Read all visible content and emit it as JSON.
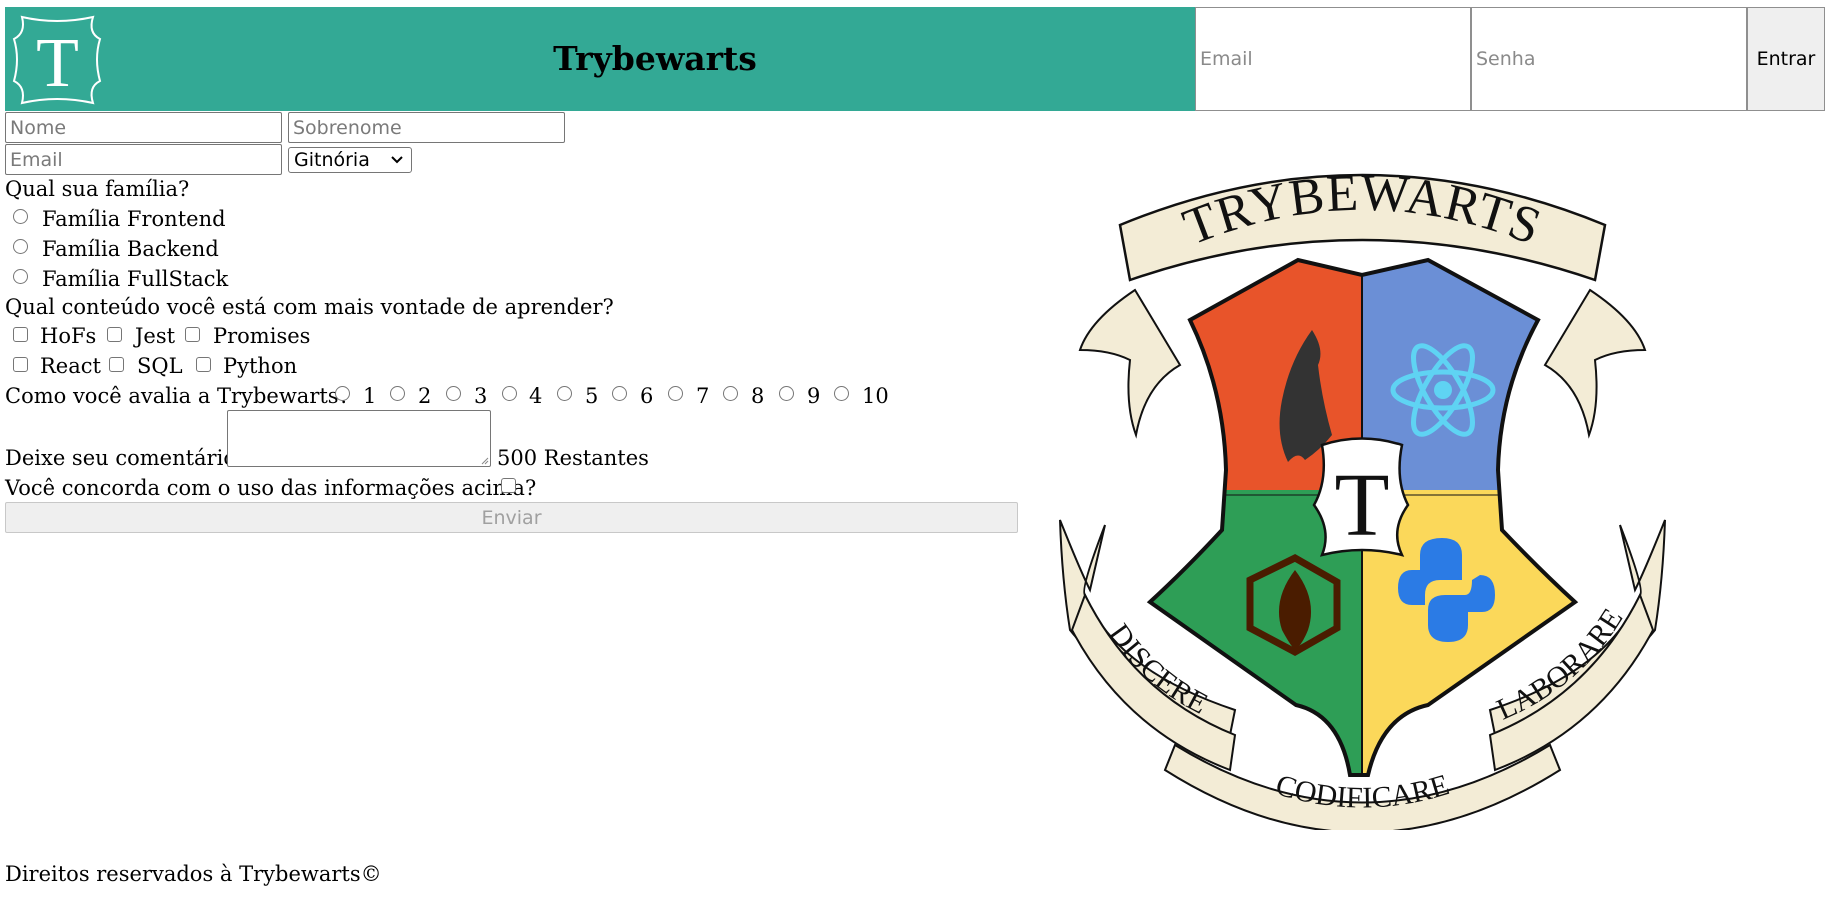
{
  "header": {
    "logo_letter": "T",
    "title": "Trybewarts",
    "email_placeholder": "Email",
    "password_placeholder": "Senha",
    "login_label": "Entrar"
  },
  "form": {
    "name_placeholder": "Nome",
    "lastname_placeholder": "Sobrenome",
    "email_placeholder": "Email",
    "house_selected": "Gitnória",
    "family_question": "Qual sua família?",
    "families": [
      "Família Frontend",
      "Família Backend",
      "Família FullStack"
    ],
    "content_question": "Qual conteúdo você está com mais vontade de aprender?",
    "subjects": [
      "HoFs",
      "Jest",
      "Promises",
      "React",
      "SQL",
      "Python"
    ],
    "rate_question": "Como você avalia a Trybewarts?",
    "ratings": [
      "1",
      "2",
      "3",
      "4",
      "5",
      "6",
      "7",
      "8",
      "9",
      "10"
    ],
    "comment_label": "Deixe seu comentário:",
    "counter": "500 Restantes",
    "agreement_label": "Você concorda com o uso das informações acima?",
    "submit_label": "Enviar"
  },
  "crest": {
    "top_banner": "TRYBEWARTS",
    "center_letter": "T",
    "motto_left": "DISCERE",
    "motto_bottom": "CODIFICARE",
    "motto_right": "LABORARE",
    "colors": {
      "orange": "#e8542a",
      "blue": "#6b8fd6",
      "green": "#2e9e56",
      "yellow": "#fbd85a",
      "parchment": "#f3ecd6"
    }
  },
  "footer": {
    "text": "Direitos reservados à Trybewarts©"
  }
}
